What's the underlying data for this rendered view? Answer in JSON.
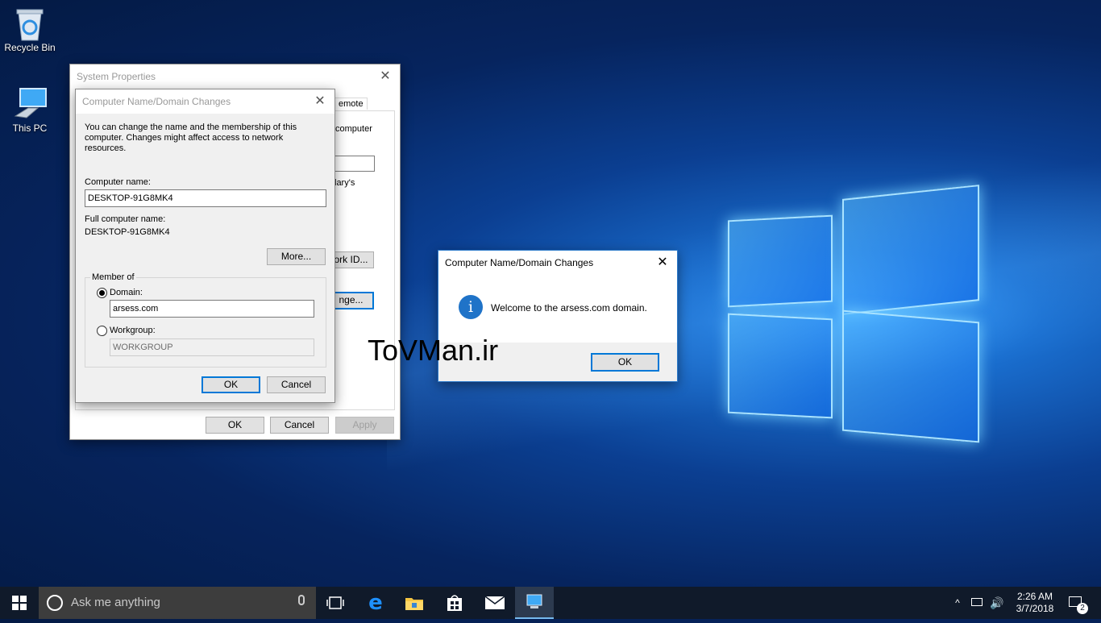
{
  "desktop": {
    "icons": [
      {
        "label": "Recycle Bin"
      },
      {
        "label": "This PC"
      }
    ],
    "watermark": "ToVMan.ir"
  },
  "system_properties": {
    "title": "System Properties",
    "tab_partial": "emote",
    "text_partial_computer": "computer",
    "text_partial_clarys": "lary's",
    "network_id_partial": "ork ID...",
    "change_partial": "nge...",
    "ok_label": "OK",
    "cancel_label": "Cancel",
    "apply_label": "Apply"
  },
  "name_changes": {
    "title": "Computer Name/Domain Changes",
    "description": "You can change the name and the membership of this computer. Changes might affect access to network resources.",
    "computer_name_label": "Computer name:",
    "computer_name_value": "DESKTOP-91G8MK4",
    "full_name_label": "Full computer name:",
    "full_name_value": "DESKTOP-91G8MK4",
    "more_label": "More...",
    "member_of_label": "Member of",
    "domain_label": "Domain:",
    "domain_value": "arsess.com",
    "workgroup_label": "Workgroup:",
    "workgroup_value": "WORKGROUP",
    "ok_label": "OK",
    "cancel_label": "Cancel"
  },
  "welcome_dialog": {
    "title": "Computer Name/Domain Changes",
    "message": "Welcome to the arsess.com domain.",
    "ok_label": "OK"
  },
  "taskbar": {
    "search_placeholder": "Ask me anything",
    "time": "2:26 AM",
    "date": "3/7/2018",
    "notification_count": "2"
  },
  "colors": {
    "accent": "#0078d7",
    "taskbar": "#101a2a"
  }
}
